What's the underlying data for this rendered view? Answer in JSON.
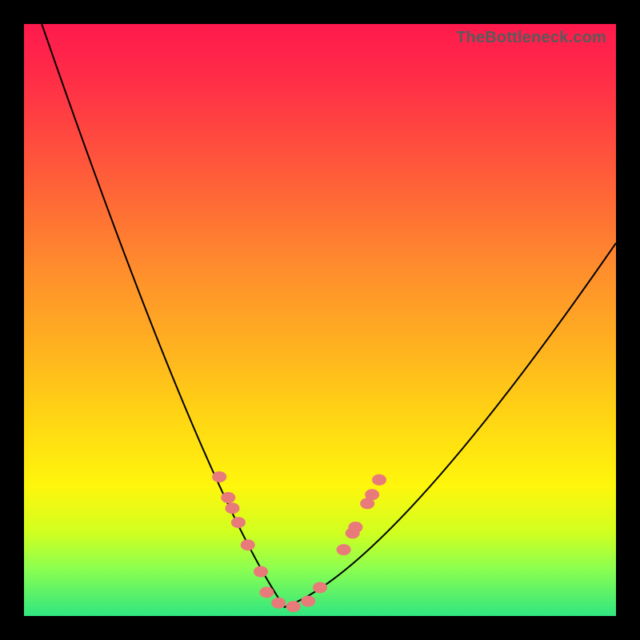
{
  "watermark": "TheBottleneck.com",
  "chart_data": {
    "type": "line",
    "title": "",
    "xlabel": "",
    "ylabel": "",
    "xlim": [
      0,
      1
    ],
    "ylim": [
      0,
      1
    ],
    "curve": {
      "minimum_x": 0.44,
      "left_start": {
        "x": 0.03,
        "y": 1.0
      },
      "right_end": {
        "x": 1.0,
        "y": 0.63
      },
      "control_left": {
        "x": 0.3,
        "y": 0.22
      },
      "control_right": {
        "x": 0.62,
        "y": 0.08
      }
    },
    "series": [
      {
        "name": "markers-left",
        "points": [
          {
            "x": 0.33,
            "y": 0.235
          },
          {
            "x": 0.345,
            "y": 0.2
          },
          {
            "x": 0.352,
            "y": 0.182
          },
          {
            "x": 0.362,
            "y": 0.158
          },
          {
            "x": 0.378,
            "y": 0.12
          },
          {
            "x": 0.4,
            "y": 0.075
          }
        ]
      },
      {
        "name": "markers-bottom",
        "points": [
          {
            "x": 0.41,
            "y": 0.04
          },
          {
            "x": 0.43,
            "y": 0.022
          },
          {
            "x": 0.455,
            "y": 0.016
          },
          {
            "x": 0.48,
            "y": 0.025
          },
          {
            "x": 0.5,
            "y": 0.048
          }
        ]
      },
      {
        "name": "markers-right",
        "points": [
          {
            "x": 0.54,
            "y": 0.112
          },
          {
            "x": 0.555,
            "y": 0.14
          },
          {
            "x": 0.56,
            "y": 0.15
          },
          {
            "x": 0.58,
            "y": 0.19
          },
          {
            "x": 0.588,
            "y": 0.205
          },
          {
            "x": 0.6,
            "y": 0.23
          }
        ]
      }
    ],
    "colors": {
      "curve": "#000000",
      "marker": "#e97a7a",
      "gradient_top": "#ff1a4d",
      "gradient_bottom": "#30e680"
    }
  }
}
